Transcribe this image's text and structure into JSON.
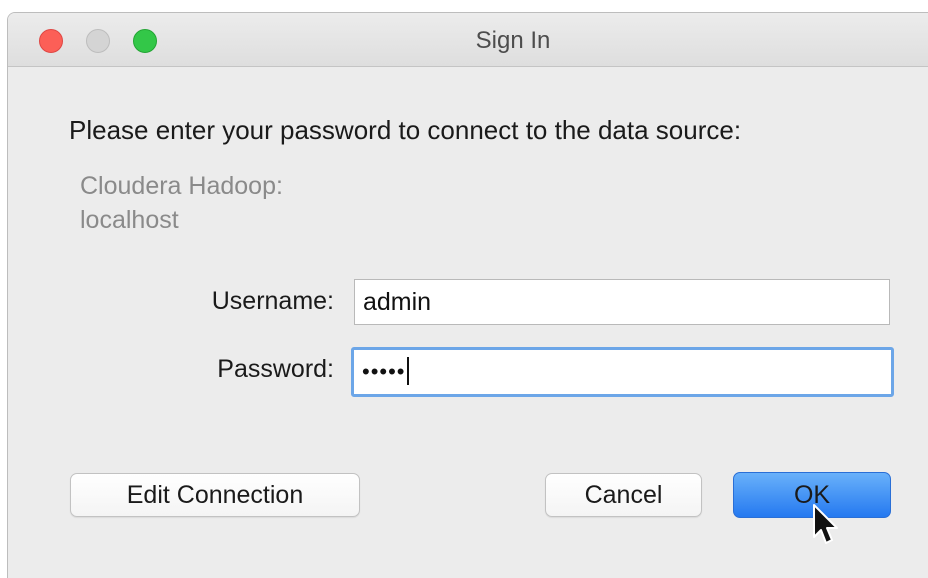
{
  "window": {
    "title": "Sign In",
    "controls": {
      "close": "close-button",
      "minimize": "minimize-button",
      "zoom": "zoom-button"
    }
  },
  "dialog": {
    "prompt": "Please enter your password to connect to the data source:",
    "source_line1": "Cloudera Hadoop:",
    "source_line2": "localhost",
    "username_label": "Username:",
    "username_value": "admin",
    "password_label": "Password:",
    "password_masked": "•••••"
  },
  "buttons": {
    "edit_connection": "Edit Connection",
    "cancel": "Cancel",
    "ok": "OK"
  },
  "colors": {
    "ok_button": "#2a7ff2",
    "focus_ring": "#6ca6e8",
    "close": "#fc5f57",
    "zoom": "#33c748"
  },
  "icons": {
    "pointer": "mouse-pointer-icon"
  }
}
